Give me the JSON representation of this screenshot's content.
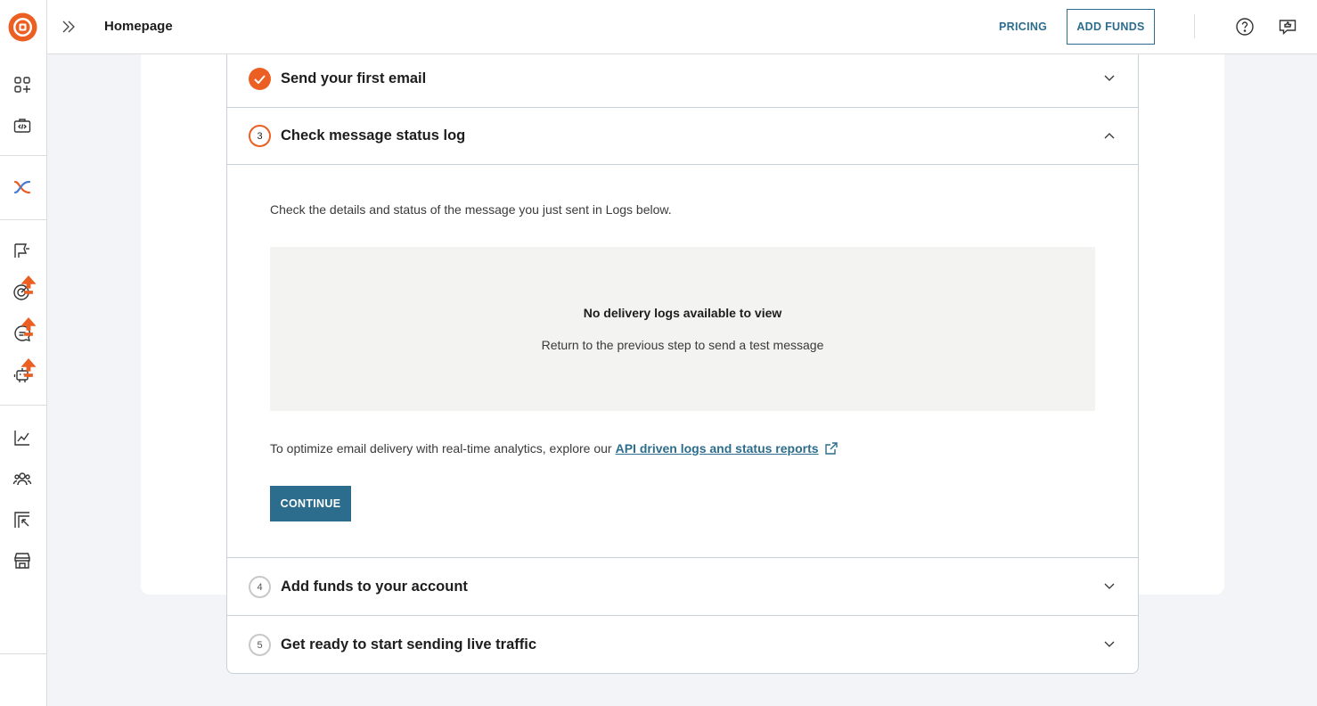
{
  "header": {
    "title": "Homepage",
    "pricing_label": "PRICING",
    "add_funds_label": "ADD FUNDS"
  },
  "sidebar": {
    "icons": [
      "dashboard-add-icon",
      "api-briefcase-icon",
      "integrations-icon",
      "campaigns-icon",
      "targeting-icon",
      "conversations-icon",
      "bot-icon",
      "analytics-icon",
      "contacts-icon",
      "export-icon",
      "marketplace-icon"
    ]
  },
  "steps": [
    {
      "number": "",
      "title": "Send your first email",
      "state": "done"
    },
    {
      "number": "3",
      "title": "Check message status log",
      "state": "active"
    },
    {
      "number": "4",
      "title": "Add funds to your account",
      "state": "pending"
    },
    {
      "number": "5",
      "title": "Get ready to start sending live traffic",
      "state": "pending"
    }
  ],
  "active_step": {
    "description": "Check the details and status of the message you just sent in Logs below.",
    "empty_title": "No delivery logs available to view",
    "empty_subtitle": "Return to the previous step to send a test message",
    "optimize_text": "To optimize email delivery with real-time analytics, explore our",
    "api_link": "API driven logs and status reports",
    "continue_label": "CONTINUE"
  },
  "colors": {
    "accent": "#ec5f22",
    "primary": "#2c6c8c",
    "background": "#f2f4f8"
  }
}
